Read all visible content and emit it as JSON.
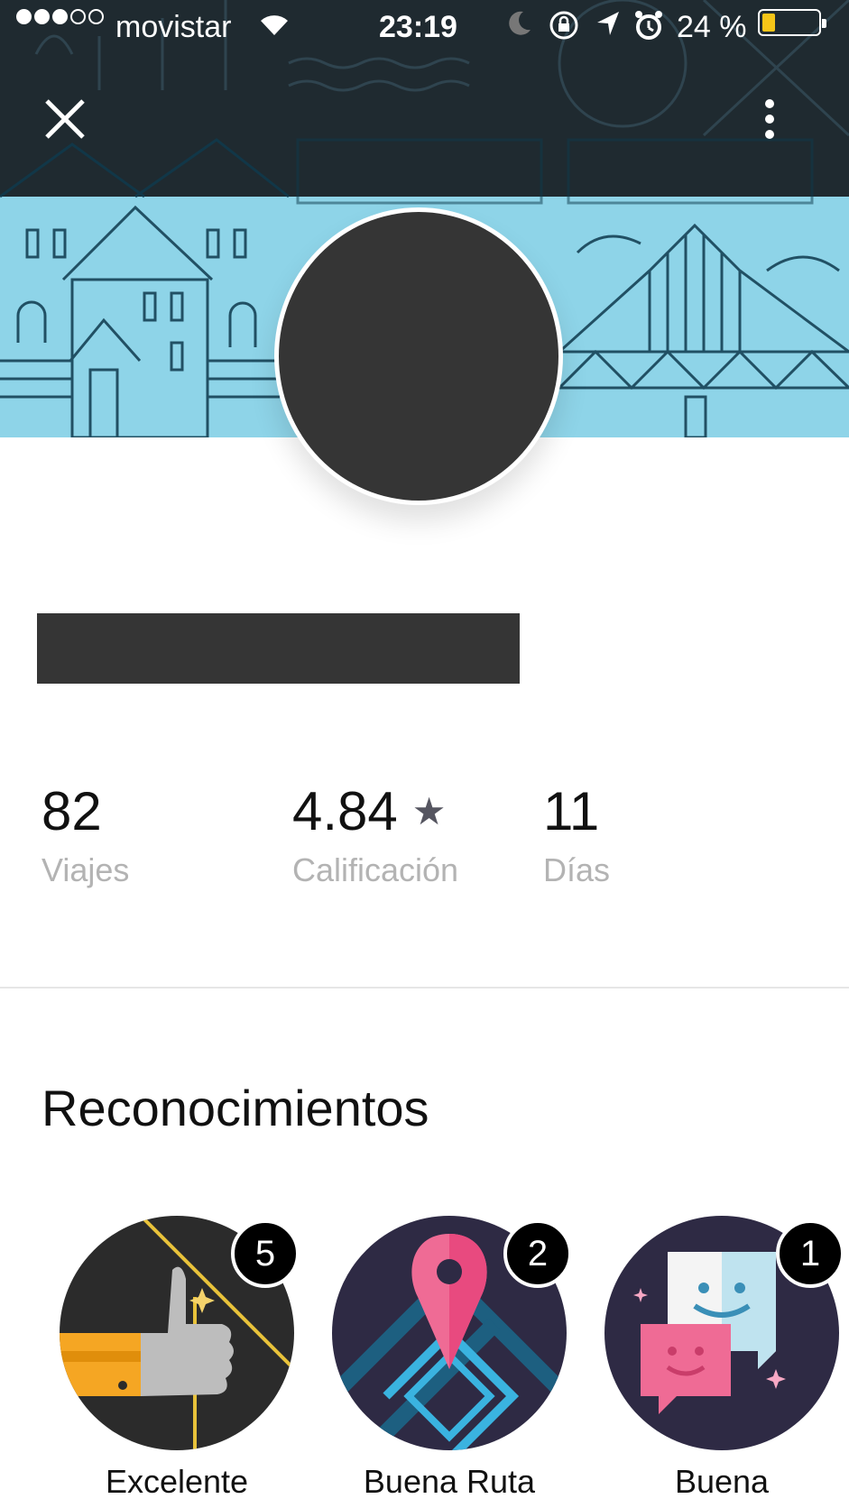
{
  "status_bar": {
    "carrier": "movistar",
    "time": "23:19",
    "battery_percent": "24 %",
    "battery_level": 0.24
  },
  "profile": {
    "stats": [
      {
        "value": "82",
        "label": "Viajes"
      },
      {
        "value": "4.84",
        "label": "Calificación"
      },
      {
        "value": "11",
        "label": "Días"
      }
    ]
  },
  "recognitions": {
    "title": "Reconocimientos",
    "badges": [
      {
        "count": "5",
        "label": "Excelente"
      },
      {
        "count": "2",
        "label": "Buena Ruta"
      },
      {
        "count": "1",
        "label": "Buena"
      }
    ]
  },
  "colors": {
    "banner_dark": "#1f2a30",
    "banner_light": "#8ed4e8",
    "avatar": "#353535",
    "star": "#555560"
  }
}
